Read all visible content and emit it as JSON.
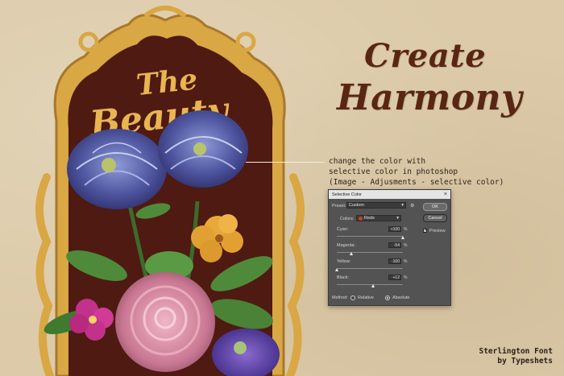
{
  "headline": {
    "line1": "Create",
    "line2": "Harmony"
  },
  "artwork": {
    "title_line1": "The",
    "title_line2": "Beauty"
  },
  "callout": {
    "line1": "change the color with",
    "line2": "selective color in photoshop",
    "line3": "(Image - Adjusments - selective color)"
  },
  "dialog": {
    "title": "Selective Color",
    "preset_label": "Preset:",
    "preset_value": "Custom",
    "colors_label": "Colors:",
    "colors_value": "Reds",
    "ok_label": "OK",
    "cancel_label": "Cancel",
    "preview_label": "Preview",
    "sliders": [
      {
        "label": "Cyan:",
        "value": "+100",
        "unit": "%",
        "position": 1.0
      },
      {
        "label": "Magenta:",
        "value": "-54",
        "unit": "%",
        "position": 0.23
      },
      {
        "label": "Yellow:",
        "value": "-100",
        "unit": "%",
        "position": 0.0
      },
      {
        "label": "Black:",
        "value": "+12",
        "unit": "%",
        "position": 0.56
      }
    ],
    "method_label": "Method:",
    "method_relative": "Relative",
    "method_absolute": "Absolute",
    "reds_swatch_color": "#d23a2a"
  },
  "credit": {
    "line1": "Sterlington Font",
    "line2": "by Typeshets"
  },
  "colors": {
    "background": "#dccaa8",
    "brown": "#5a2614",
    "gold": "#d9a743",
    "maroon": "#4e1a12"
  }
}
